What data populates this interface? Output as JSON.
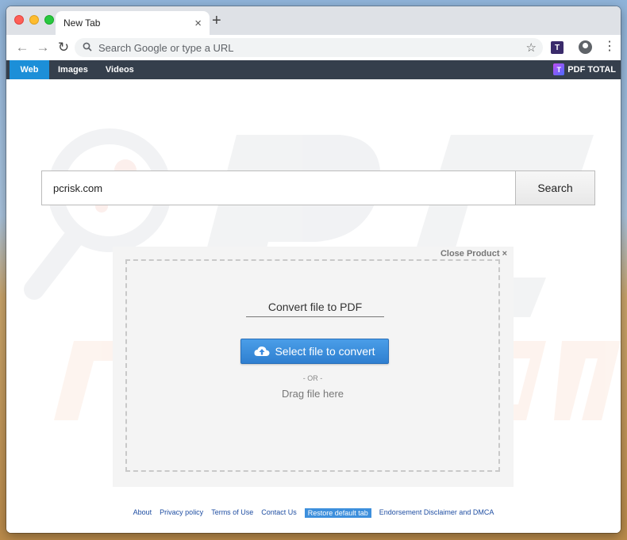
{
  "tab": {
    "title": "New Tab",
    "close_glyph": "×",
    "new_tab_glyph": "+"
  },
  "toolbar": {
    "back_glyph": "←",
    "forward_glyph": "→",
    "reload_glyph": "↻",
    "omnibox_placeholder": "Search Google or type a URL",
    "search_glyph": "⚲",
    "star_glyph": "☆",
    "menu_glyph": "⋮"
  },
  "nav": {
    "items": [
      {
        "label": "Web",
        "active": true
      },
      {
        "label": "Images",
        "active": false
      },
      {
        "label": "Videos",
        "active": false
      }
    ],
    "brand": "PDF TOTAL"
  },
  "search": {
    "value": "pcrisk.com",
    "button_label": "Search"
  },
  "product": {
    "close_label": "Close Product ×",
    "title": "Convert file to PDF",
    "select_button": "Select file to convert",
    "or_label": "- OR -",
    "drag_label": "Drag file here"
  },
  "footer": {
    "links": [
      {
        "label": "About"
      },
      {
        "label": "Privacy policy"
      },
      {
        "label": "Terms of Use"
      },
      {
        "label": "Contact Us"
      },
      {
        "label": "Restore default tab",
        "highlight": true
      },
      {
        "label": "Endorsement Disclaimer and DMCA"
      }
    ]
  },
  "colors": {
    "nav_bg": "#353f4c",
    "nav_active": "#1c8fd8",
    "button_blue": "#2f7fd0",
    "link": "#1f4ea2"
  }
}
